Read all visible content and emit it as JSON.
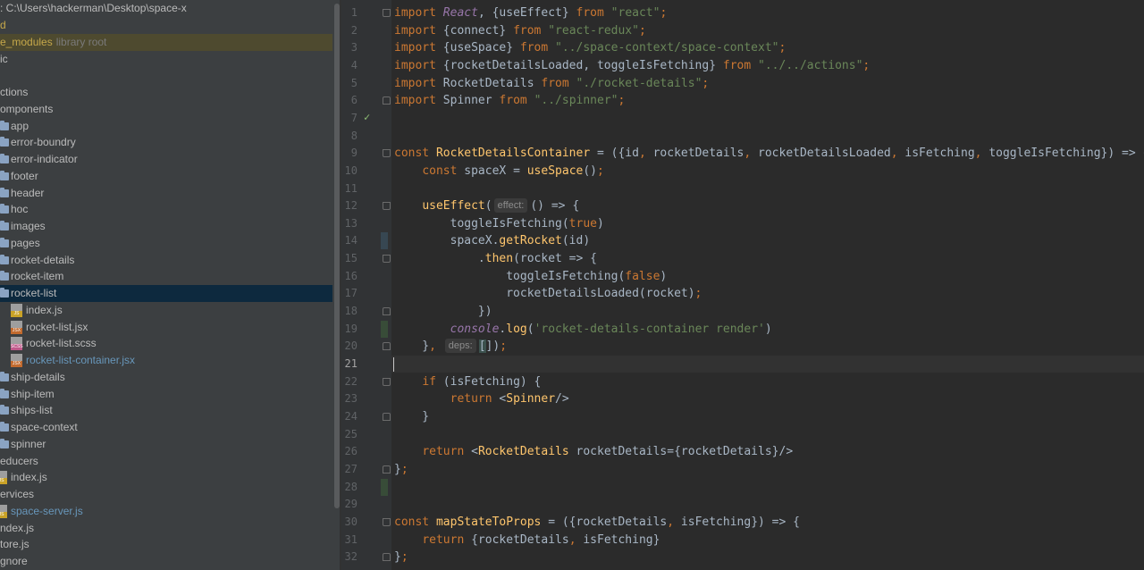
{
  "project": {
    "path": ": C:\\Users\\hackerman\\Desktop\\space-x",
    "items": [
      {
        "label": "d",
        "indent": 0,
        "kind": "text",
        "color": "yel"
      },
      {
        "label": "e_modules",
        "suffix": "library root",
        "indent": 0,
        "kind": "text",
        "color": "yel",
        "hl": "yellow"
      },
      {
        "label": "ic",
        "indent": 0,
        "kind": "text"
      },
      {
        "label": "",
        "indent": 0,
        "kind": "text"
      },
      {
        "label": "ctions",
        "indent": 0,
        "kind": "text"
      },
      {
        "label": "omponents",
        "indent": 0,
        "kind": "text"
      },
      {
        "label": "app",
        "indent": 12,
        "kind": "folder"
      },
      {
        "label": "error-boundry",
        "indent": 12,
        "kind": "folder"
      },
      {
        "label": "error-indicator",
        "indent": 12,
        "kind": "folder"
      },
      {
        "label": "footer",
        "indent": 12,
        "kind": "folder"
      },
      {
        "label": "header",
        "indent": 12,
        "kind": "folder"
      },
      {
        "label": "hoc",
        "indent": 12,
        "kind": "folder"
      },
      {
        "label": "images",
        "indent": 12,
        "kind": "folder"
      },
      {
        "label": "pages",
        "indent": 12,
        "kind": "folder"
      },
      {
        "label": "rocket-details",
        "indent": 12,
        "kind": "folder"
      },
      {
        "label": "rocket-item",
        "indent": 12,
        "kind": "folder"
      },
      {
        "label": "rocket-list",
        "indent": 12,
        "kind": "folder",
        "sel": true
      },
      {
        "label": "index.js",
        "indent": 29,
        "kind": "file",
        "ftype": "JS"
      },
      {
        "label": "rocket-list.jsx",
        "indent": 29,
        "kind": "file",
        "ftype": "JSX"
      },
      {
        "label": "rocket-list.scss",
        "indent": 29,
        "kind": "file",
        "ftype": "SCSS"
      },
      {
        "label": "rocket-list-container.jsx",
        "indent": 29,
        "kind": "file",
        "ftype": "JSX",
        "color": "blue"
      },
      {
        "label": "ship-details",
        "indent": 12,
        "kind": "folder"
      },
      {
        "label": "ship-item",
        "indent": 12,
        "kind": "folder"
      },
      {
        "label": "ships-list",
        "indent": 12,
        "kind": "folder"
      },
      {
        "label": "space-context",
        "indent": 12,
        "kind": "folder"
      },
      {
        "label": "spinner",
        "indent": 12,
        "kind": "folder"
      },
      {
        "label": "educers",
        "indent": 0,
        "kind": "text"
      },
      {
        "label": "index.js",
        "indent": 12,
        "kind": "file",
        "ftype": "JS"
      },
      {
        "label": "ervices",
        "indent": 0,
        "kind": "text"
      },
      {
        "label": "space-server.js",
        "indent": 12,
        "kind": "file",
        "ftype": "JS",
        "color": "blue"
      },
      {
        "label": "ndex.js",
        "indent": 0,
        "kind": "text"
      },
      {
        "label": "tore.js",
        "indent": 0,
        "kind": "text"
      },
      {
        "label": "gnore",
        "indent": 0,
        "kind": "text"
      }
    ]
  },
  "editor": {
    "current_line": 21,
    "lines": [
      [
        [
          "kw",
          "import "
        ],
        [
          "cls",
          "React"
        ],
        [
          "pl",
          ", {"
        ],
        [
          "pl",
          "useEffect"
        ],
        [
          "pl",
          "} "
        ],
        [
          "kw",
          "from "
        ],
        [
          "str",
          "\"react\""
        ],
        [
          "kw",
          ";"
        ]
      ],
      [
        [
          "kw",
          "import "
        ],
        [
          "pl",
          "{connect} "
        ],
        [
          "kw",
          "from "
        ],
        [
          "str",
          "\"react-redux\""
        ],
        [
          "kw",
          ";"
        ]
      ],
      [
        [
          "kw",
          "import "
        ],
        [
          "pl",
          "{useSpace} "
        ],
        [
          "kw",
          "from "
        ],
        [
          "str",
          "\"../space-context/space-context\""
        ],
        [
          "kw",
          ";"
        ]
      ],
      [
        [
          "kw",
          "import "
        ],
        [
          "pl",
          "{rocketDetailsLoaded, toggleIsFetching} "
        ],
        [
          "kw",
          "from "
        ],
        [
          "str",
          "\"../../actions\""
        ],
        [
          "kw",
          ";"
        ]
      ],
      [
        [
          "kw",
          "import "
        ],
        [
          "pl",
          "RocketDetails "
        ],
        [
          "kw",
          "from "
        ],
        [
          "str",
          "\"./rocket-details\""
        ],
        [
          "kw",
          ";"
        ]
      ],
      [
        [
          "kw",
          "import "
        ],
        [
          "pl",
          "Spinner "
        ],
        [
          "kw",
          "from "
        ],
        [
          "str",
          "\"../spinner\""
        ],
        [
          "kw",
          ";"
        ]
      ],
      [],
      [],
      [
        [
          "kw",
          "const "
        ],
        [
          "fn",
          "RocketDetailsContainer"
        ],
        [
          "pl",
          " = ({id"
        ],
        [
          "kw",
          ", "
        ],
        [
          "pl",
          "rocketDetails"
        ],
        [
          "kw",
          ", "
        ],
        [
          "pl",
          "rocketDetailsLoaded"
        ],
        [
          "kw",
          ", "
        ],
        [
          "pl",
          "isFetching"
        ],
        [
          "kw",
          ", "
        ],
        [
          "pl",
          "toggleIsFetching}) => {"
        ]
      ],
      [
        [
          "pl",
          "    "
        ],
        [
          "kw",
          "const "
        ],
        [
          "pl",
          "spaceX = "
        ],
        [
          "fn",
          "useSpace"
        ],
        [
          "pl",
          "()"
        ],
        [
          "kw",
          ";"
        ]
      ],
      [],
      [
        [
          "pl",
          "    "
        ],
        [
          "fn",
          "useEffect"
        ],
        [
          "pl",
          "("
        ],
        [
          "hint",
          "effect:"
        ],
        [
          "pl",
          "() => {"
        ]
      ],
      [
        [
          "pl",
          "        toggleIsFetching("
        ],
        [
          "kw",
          "true"
        ],
        [
          "pl",
          ")"
        ]
      ],
      [
        [
          "pl",
          "        spaceX."
        ],
        [
          "fn",
          "getRocket"
        ],
        [
          "pl",
          "(id)"
        ]
      ],
      [
        [
          "pl",
          "            ."
        ],
        [
          "fn",
          "then"
        ],
        [
          "pl",
          "(rocket => {"
        ]
      ],
      [
        [
          "pl",
          "                toggleIsFetching("
        ],
        [
          "kw",
          "false"
        ],
        [
          "pl",
          ")"
        ]
      ],
      [
        [
          "pl",
          "                rocketDetailsLoaded(rocket)"
        ],
        [
          "kw",
          ";"
        ]
      ],
      [
        [
          "pl",
          "            })"
        ]
      ],
      [
        [
          "pl",
          "        "
        ],
        [
          "cls",
          "console"
        ],
        [
          "pl",
          "."
        ],
        [
          "fn",
          "log"
        ],
        [
          "pl",
          "("
        ],
        [
          "str",
          "'rocket-details-container render'"
        ],
        [
          "pl",
          ")"
        ]
      ],
      [
        [
          "pl",
          "    }"
        ],
        [
          "kw",
          ", "
        ],
        [
          "hint",
          "deps:"
        ],
        [
          "brk",
          "["
        ],
        [
          "pl",
          "])"
        ],
        [
          "kw",
          ";"
        ]
      ],
      [],
      [
        [
          "pl",
          "    "
        ],
        [
          "kw",
          "if "
        ],
        [
          "pl",
          "(isFetching) {"
        ]
      ],
      [
        [
          "pl",
          "        "
        ],
        [
          "kw",
          "return "
        ],
        [
          "pl",
          "<"
        ],
        [
          "fn",
          "Spinner"
        ],
        [
          "pl",
          "/>"
        ]
      ],
      [
        [
          "pl",
          "    }"
        ]
      ],
      [],
      [
        [
          "pl",
          "    "
        ],
        [
          "kw",
          "return "
        ],
        [
          "pl",
          "<"
        ],
        [
          "fn",
          "RocketDetails "
        ],
        [
          "pl",
          "rocketDetails={rocketDetails}/>"
        ]
      ],
      [
        [
          "pl",
          "}"
        ],
        [
          "kw",
          ";"
        ]
      ],
      [],
      [],
      [
        [
          "kw",
          "const "
        ],
        [
          "fn",
          "mapStateToProps"
        ],
        [
          "pl",
          " = ({rocketDetails"
        ],
        [
          "kw",
          ", "
        ],
        [
          "pl",
          "isFetching}) => {"
        ]
      ],
      [
        [
          "pl",
          "    "
        ],
        [
          "kw",
          "return "
        ],
        [
          "pl",
          "{rocketDetails"
        ],
        [
          "kw",
          ", "
        ],
        [
          "pl",
          "isFetching}"
        ]
      ],
      [
        [
          "pl",
          "}"
        ],
        [
          "kw",
          ";"
        ]
      ]
    ],
    "folds": [
      [
        1,
        "up"
      ],
      [
        6,
        "dn"
      ],
      [
        9,
        "up"
      ],
      [
        12,
        "up"
      ],
      [
        15,
        "up"
      ],
      [
        18,
        "dn"
      ],
      [
        20,
        "dn"
      ],
      [
        22,
        "up"
      ],
      [
        24,
        "dn"
      ],
      [
        27,
        "dn"
      ],
      [
        30,
        "up"
      ],
      [
        32,
        "dn"
      ]
    ],
    "changes": [
      [
        14,
        "mod"
      ],
      [
        19,
        "add"
      ],
      [
        28,
        "add"
      ]
    ]
  }
}
